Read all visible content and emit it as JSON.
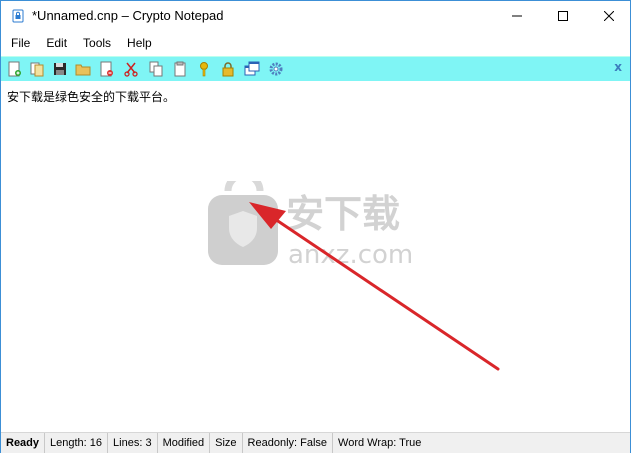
{
  "window": {
    "title": "*Unnamed.cnp – Crypto Notepad",
    "min_glyph": "—",
    "max_glyph": "☐",
    "close_glyph": "✕"
  },
  "menu": {
    "items": [
      "File",
      "Edit",
      "Tools",
      "Help"
    ]
  },
  "toolbar": {
    "background": "#7ff5f5",
    "buttons": [
      "new-file-icon",
      "open-icon",
      "save-icon",
      "folder-icon",
      "delete-file-icon",
      "cut-icon",
      "copy-icon",
      "paste-icon",
      "key-icon",
      "lock-icon",
      "windows-icon",
      "settings-icon"
    ],
    "close_label": "x"
  },
  "editor": {
    "content": "安下载是绿色安全的下载平台。"
  },
  "watermark": {
    "brand": "安下载",
    "domain": "anxz.com"
  },
  "status": {
    "ready": "Ready",
    "length": "Length: 16",
    "lines": "Lines: 3",
    "modified": "Modified",
    "size": "Size",
    "readonly": "Readonly: False",
    "wordwrap": "Word Wrap: True"
  },
  "colors": {
    "window_border": "#3c8fd6",
    "arrow": "#d9262a",
    "watermark": "#c8c8c8"
  }
}
